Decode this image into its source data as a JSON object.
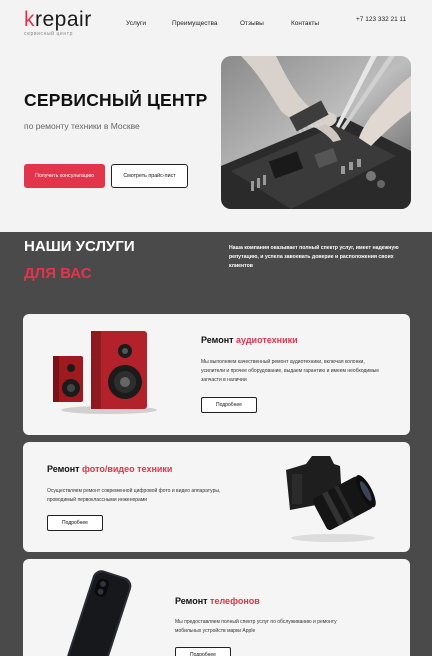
{
  "header": {
    "logo": "krepair",
    "logo_sub": "сервисный центр",
    "nav": [
      "Услуги",
      "Преимущества",
      "Отзывы",
      "Контакты"
    ],
    "phone": "+7 123 332 21 11"
  },
  "hero": {
    "title": "СЕРВИСНЫЙ ЦЕНТР",
    "subtitle": "по ремонту техники в Москве",
    "btn_primary": "Получить консультацию",
    "btn_secondary": "Смотреть прайс-лист"
  },
  "services": {
    "title_line1": "НАШИ УСЛУГИ",
    "title_line2": "ДЛЯ ВАС",
    "description": "Наша компания оказывает полный спектр услуг, имеет надежную репутацию, и успела завоевать доверие и расположения своих клиентов",
    "cards": [
      {
        "title_prefix": "Ремонт ",
        "title_accent": "аудиотехники",
        "text": "Мы выполняем качественный ремонт аудиотехники, включая колонки, усилители и прочее оборудование, выдаем гарантию и имеем необходимые запчасти в наличии",
        "button": "Подробнее"
      },
      {
        "title_prefix": "Ремонт ",
        "title_accent": "фото/видео техники",
        "text": "Осуществляем ремонт современной цифровой фото и видео аппаратуры, проводимый первоклассными инженерами",
        "button": "Подробнее"
      },
      {
        "title_prefix": "Ремонт ",
        "title_accent": "телефонов",
        "text": "Мы предоставляем полный спектр услуг по обслуживанию и ремонту мобильных устройств марки Apple",
        "button": "Подробнее"
      }
    ]
  },
  "colors": {
    "accent": "#e2344a",
    "dark": "#4a4a4a",
    "light": "#f3f3f3"
  }
}
